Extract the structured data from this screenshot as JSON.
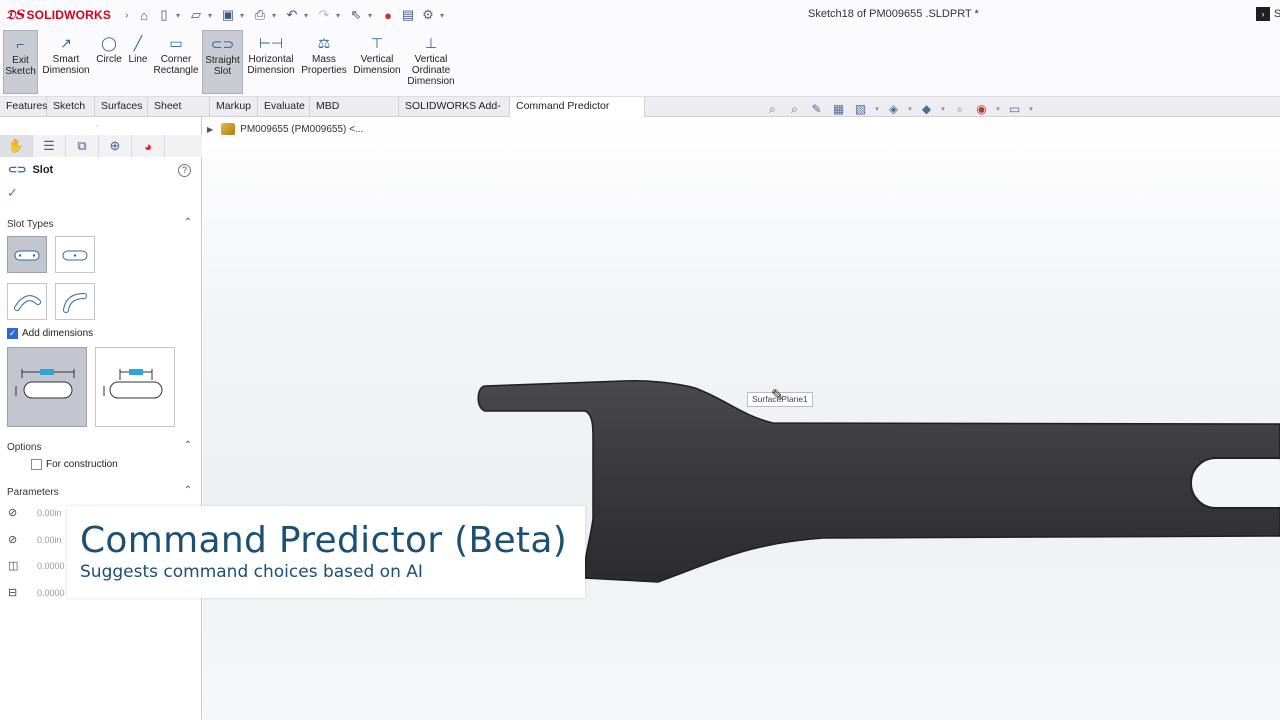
{
  "app": {
    "logo_text": "SOLIDWORKS",
    "document_title": "Sketch18 of PM009655 .SLDPRT *",
    "right_label": "S"
  },
  "quick_access": {
    "icons": [
      "home-icon",
      "new-document-icon",
      "open-icon",
      "save-icon",
      "print-icon",
      "undo-icon",
      "redo-icon",
      "select-icon",
      "rebuild-icon",
      "file-properties-icon",
      "options-icon"
    ]
  },
  "ribbon": {
    "buttons": [
      {
        "label": "Exit\nSketch",
        "icon": "exit-sketch-icon",
        "pressed": true
      },
      {
        "label": "Smart\nDimension",
        "icon": "smart-dimension-icon"
      },
      {
        "label": "Circle",
        "icon": "circle-icon"
      },
      {
        "label": "Line",
        "icon": "line-icon"
      },
      {
        "label": "Corner\nRectangle",
        "icon": "rectangle-icon"
      },
      {
        "label": "Straight\nSlot",
        "icon": "straight-slot-icon",
        "pressed": true
      },
      {
        "label": "Horizontal\nDimension",
        "icon": "horizontal-dimension-icon"
      },
      {
        "label": "Mass\nProperties",
        "icon": "mass-properties-icon"
      },
      {
        "label": "Vertical\nDimension",
        "icon": "vertical-dimension-icon"
      },
      {
        "label": "Vertical\nOrdinate\nDimension",
        "icon": "vertical-ordinate-dimension-icon"
      }
    ]
  },
  "tabs": [
    {
      "label": "Features"
    },
    {
      "label": "Sketch"
    },
    {
      "label": "Surfaces"
    },
    {
      "label": "Sheet Metal"
    },
    {
      "label": "Markup"
    },
    {
      "label": "Evaluate"
    },
    {
      "label": "MBD Dimensions"
    },
    {
      "label": "SOLIDWORKS Add-Ins"
    },
    {
      "label": "Command Predictor (beta)",
      "active": true
    }
  ],
  "panel": {
    "title": "Slot",
    "help": "?",
    "ok": "✓",
    "slot_types_label": "Slot Types",
    "add_dimensions_label": "Add dimensions",
    "add_dimensions_checked": true,
    "options_label": "Options",
    "for_construction_label": "For construction",
    "for_construction_checked": false,
    "parameters_label": "Parameters",
    "parameters": [
      {
        "icon": "x-coordinate-icon",
        "value": "0.00in"
      },
      {
        "icon": "y-coordinate-icon",
        "value": "0.00in"
      },
      {
        "icon": "slot-width-icon",
        "value": "0.0000"
      },
      {
        "icon": "slot-length-icon",
        "value": "0.0000"
      }
    ]
  },
  "viewport": {
    "tree_text": "PM009655  (PM009655)  <...",
    "tooltip": "SurfacePlane1"
  },
  "caption": {
    "title": "Command Predictor (Beta)",
    "subtitle": "Suggests command choices based on AI"
  },
  "colors": {
    "accent": "#3266a8",
    "caption_text": "#1b4f73",
    "part": "#3a3a3c",
    "brand": "#d6001c"
  }
}
